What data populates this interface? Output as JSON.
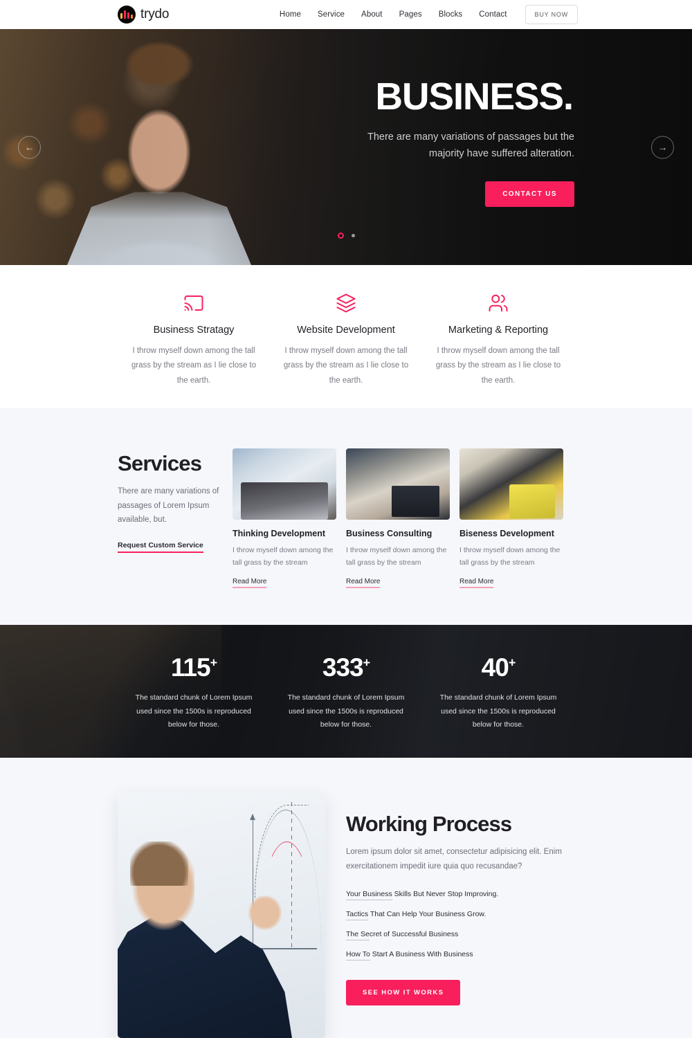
{
  "theme": {
    "accent": "#f81f5c",
    "dark": "#1f1f25",
    "muted": "#7a7a84",
    "section_bg": "#f6f7fb"
  },
  "header": {
    "brand_name": "trydo",
    "nav": [
      {
        "label": "Home"
      },
      {
        "label": "Service"
      },
      {
        "label": "About"
      },
      {
        "label": "Pages"
      },
      {
        "label": "Blocks"
      },
      {
        "label": "Contact"
      }
    ],
    "buy_now_label": "BUY NOW"
  },
  "hero": {
    "title": "BUSINESS.",
    "subtitle": "There are many variations of passages but the majority have suffered alteration.",
    "cta_label": "CONTACT US",
    "prev_icon": "←",
    "next_icon": "→",
    "slide_count": 2,
    "active_slide": 1
  },
  "features": [
    {
      "icon": "cast-icon",
      "title": "Business Stratagy",
      "text": "I throw myself down among the tall grass by the stream as I lie close to the earth."
    },
    {
      "icon": "layers-icon",
      "title": "Website Development",
      "text": "I throw myself down among the tall grass by the stream as I lie close to the earth."
    },
    {
      "icon": "users-icon",
      "title": "Marketing & Reporting",
      "text": "I throw myself down among the tall grass by the stream as I lie close to the earth."
    }
  ],
  "services": {
    "heading": "Services",
    "description": "There are many variations of passages of Lorem Ipsum available, but.",
    "link_label": "Request Custom Service",
    "cards": [
      {
        "image": "man-writing-at-laptop-photo",
        "title": "Thinking Development",
        "text": "I throw myself down among the tall grass by the stream",
        "more_label": "Read More"
      },
      {
        "image": "two-people-video-call-photo",
        "title": "Business Consulting",
        "text": "I throw myself down among the tall grass by the stream",
        "more_label": "Read More"
      },
      {
        "image": "team-with-yellow-laptop-photo",
        "title": "Biseness Development",
        "text": "I throw myself down among the tall grass by the stream",
        "more_label": "Read More"
      }
    ]
  },
  "counters": [
    {
      "number": "115",
      "suffix": "+",
      "text": "The standard chunk of Lorem Ipsum used since the 1500s is reproduced below for those."
    },
    {
      "number": "333",
      "suffix": "+",
      "text": "The standard chunk of Lorem Ipsum used since the 1500s is reproduced below for those."
    },
    {
      "number": "40",
      "suffix": "+",
      "text": "The standard chunk of Lorem Ipsum used since the 1500s is reproduced below for those."
    }
  ],
  "process": {
    "image": "man-drawing-graph-on-whiteboard-photo",
    "heading": "Working Process",
    "description": "Lorem ipsum dolor sit amet, consectetur adipisicing elit. Enim exercitationem impedit iure quia quo recusandae?",
    "items": [
      {
        "lead": "Your Business",
        "rest": " Skills But Never Stop Improving."
      },
      {
        "lead": "Tactics",
        "rest": " That Can Help Your Business Grow."
      },
      {
        "lead": "The Se",
        "rest": "cret of Successful Business"
      },
      {
        "lead": "How To",
        "rest": " Start A Business With Business"
      }
    ],
    "cta_label": "SEE HOW IT WORKS"
  }
}
